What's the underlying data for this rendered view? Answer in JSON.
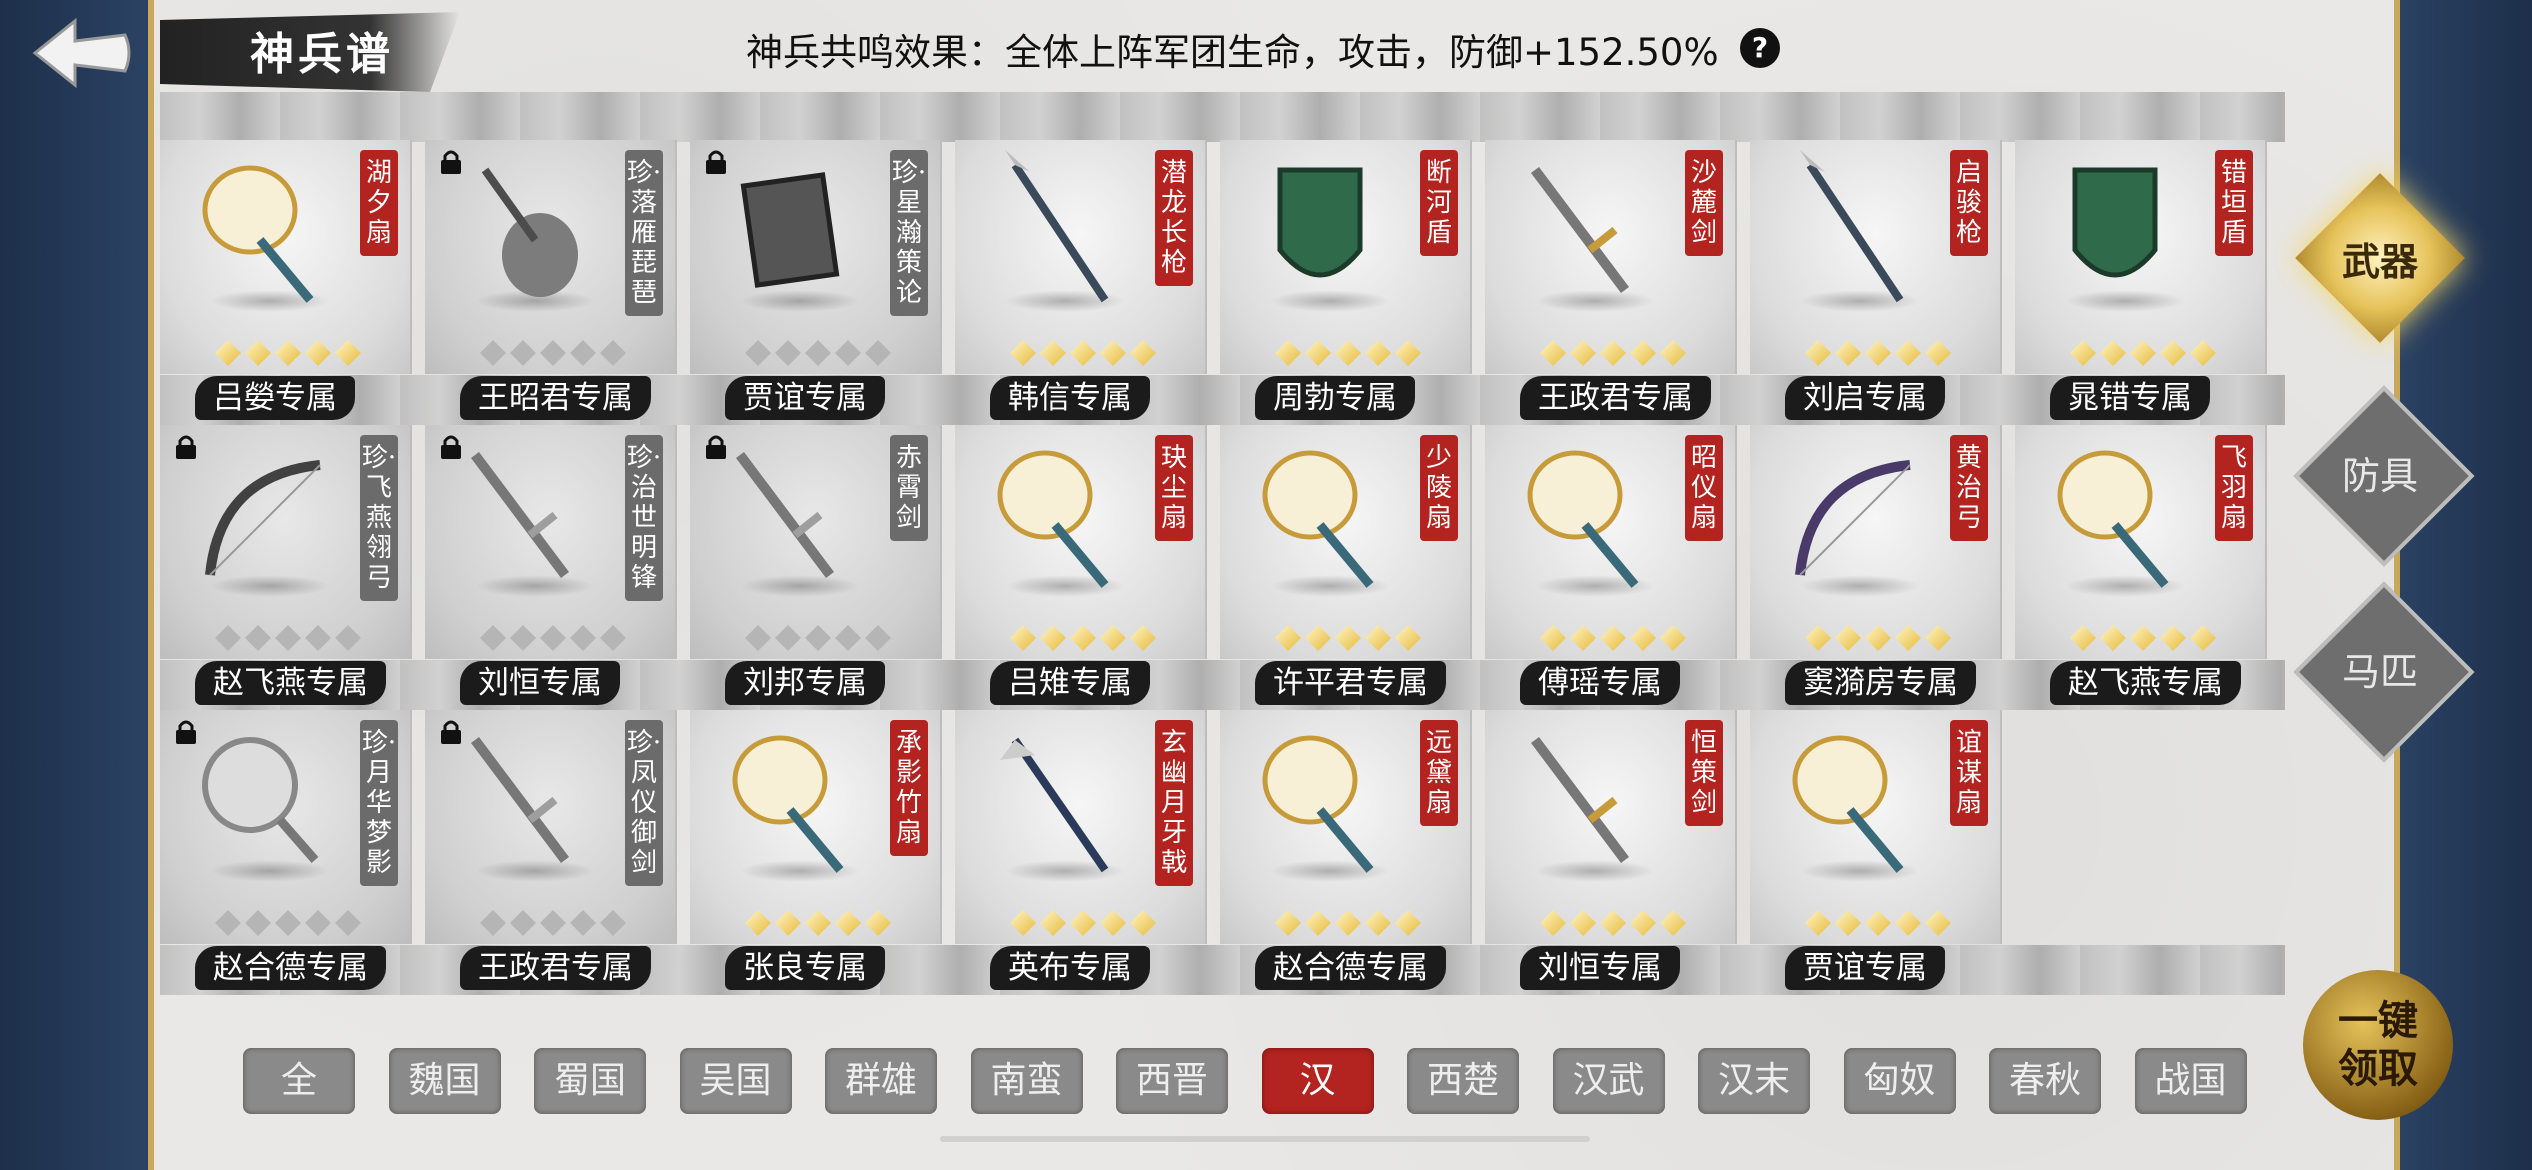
{
  "header": {
    "title": "神兵谱",
    "resonance_text": "神兵共鸣效果：全体上阵军团生命，攻击，防御+152.50%",
    "help_label": "?"
  },
  "colors": {
    "accent_red": "#b3231f",
    "gold": "#e6b93a",
    "bg_blue": "#2a3f5e"
  },
  "cards": [
    {
      "name": "湖夕扇",
      "owner": "吕嫈专属",
      "locked": false,
      "stars": 5,
      "icon": "fan-icon"
    },
    {
      "name": "珍·落雁琵琶",
      "owner": "王昭君专属",
      "locked": true,
      "stars": 5,
      "icon": "pipa-icon"
    },
    {
      "name": "珍·星瀚策论",
      "owner": "贾谊专属",
      "locked": true,
      "stars": 5,
      "icon": "book-icon"
    },
    {
      "name": "潜龙长枪",
      "owner": "韩信专属",
      "locked": false,
      "stars": 5,
      "icon": "spear-icon"
    },
    {
      "name": "断河盾",
      "owner": "周勃专属",
      "locked": false,
      "stars": 5,
      "icon": "shield-icon"
    },
    {
      "name": "沙麓剑",
      "owner": "王政君专属",
      "locked": false,
      "stars": 5,
      "icon": "sword-icon"
    },
    {
      "name": "启骏枪",
      "owner": "刘启专属",
      "locked": false,
      "stars": 5,
      "icon": "spear-icon"
    },
    {
      "name": "错垣盾",
      "owner": "晁错专属",
      "locked": false,
      "stars": 5,
      "icon": "shield-icon"
    },
    {
      "name": "珍·飞燕翎弓",
      "owner": "赵飞燕专属",
      "locked": true,
      "stars": 5,
      "icon": "bow-icon"
    },
    {
      "name": "珍·治世明锋",
      "owner": "刘恒专属",
      "locked": true,
      "stars": 5,
      "icon": "sword-icon"
    },
    {
      "name": "赤霄剑",
      "owner": "刘邦专属",
      "locked": true,
      "stars": 5,
      "icon": "sword-icon"
    },
    {
      "name": "玦尘扇",
      "owner": "吕雉专属",
      "locked": false,
      "stars": 5,
      "icon": "fan-icon"
    },
    {
      "name": "少陵扇",
      "owner": "许平君专属",
      "locked": false,
      "stars": 5,
      "icon": "fan-icon"
    },
    {
      "name": "昭仪扇",
      "owner": "傅瑶专属",
      "locked": false,
      "stars": 5,
      "icon": "fan-icon"
    },
    {
      "name": "黄治弓",
      "owner": "窦漪房专属",
      "locked": false,
      "stars": 5,
      "icon": "bow-icon"
    },
    {
      "name": "飞羽扇",
      "owner": "赵飞燕专属",
      "locked": false,
      "stars": 5,
      "icon": "fan-icon"
    },
    {
      "name": "珍·月华梦影",
      "owner": "赵合德专属",
      "locked": true,
      "stars": 5,
      "icon": "mirror-icon"
    },
    {
      "name": "珍·凤仪御剑",
      "owner": "王政君专属",
      "locked": true,
      "stars": 5,
      "icon": "sword-icon"
    },
    {
      "name": "承影竹扇",
      "owner": "张良专属",
      "locked": false,
      "stars": 5,
      "icon": "fan-icon"
    },
    {
      "name": "玄幽月牙戟",
      "owner": "英布专属",
      "locked": false,
      "stars": 5,
      "icon": "halberd-icon"
    },
    {
      "name": "远黛扇",
      "owner": "赵合德专属",
      "locked": false,
      "stars": 5,
      "icon": "fan-icon"
    },
    {
      "name": "恒策剑",
      "owner": "刘恒专属",
      "locked": false,
      "stars": 5,
      "icon": "sword-icon"
    },
    {
      "name": "谊谋扇",
      "owner": "贾谊专属",
      "locked": false,
      "stars": 5,
      "icon": "fan-icon"
    }
  ],
  "side_tabs": [
    {
      "label": "武器",
      "active": true
    },
    {
      "label": "防具",
      "active": false
    },
    {
      "label": "马匹",
      "active": false
    }
  ],
  "filters": [
    {
      "label": "全",
      "active": false
    },
    {
      "label": "魏国",
      "active": false
    },
    {
      "label": "蜀国",
      "active": false
    },
    {
      "label": "吴国",
      "active": false
    },
    {
      "label": "群雄",
      "active": false
    },
    {
      "label": "南蛮",
      "active": false
    },
    {
      "label": "西晋",
      "active": false
    },
    {
      "label": "汉",
      "active": true
    },
    {
      "label": "西楚",
      "active": false
    },
    {
      "label": "汉武",
      "active": false
    },
    {
      "label": "汉末",
      "active": false
    },
    {
      "label": "匈奴",
      "active": false
    },
    {
      "label": "春秋",
      "active": false
    },
    {
      "label": "战国",
      "active": false
    }
  ],
  "claim_button": {
    "line1": "一键",
    "line2": "领取"
  }
}
